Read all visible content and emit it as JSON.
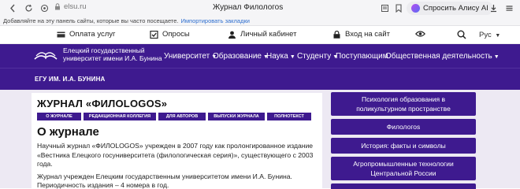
{
  "browser": {
    "url": "elsu.ru",
    "tab_title": "Журнал Филологоs",
    "alice_label": "Спросить Алису AI",
    "bookmarks_prompt": "Добавляйте на эту панель сайты, которые вы часто посещаете.",
    "bookmarks_import": "Импортировать закладки"
  },
  "utility": {
    "payment": "Оплата услуг",
    "surveys": "Опросы",
    "cabinet": "Личный кабинет",
    "login": "Вход на сайт",
    "language": "Рус"
  },
  "nav": {
    "logo_text": "Елецкий государственный университет имени И.А. Бунина",
    "items": [
      {
        "label": "Университет"
      },
      {
        "label": "Образование"
      },
      {
        "label": "Наука"
      },
      {
        "label": "Студенту"
      },
      {
        "label": "Поступающим"
      },
      {
        "label": "Общественная деятельность"
      }
    ],
    "brand": "ЕГУ ИМ. И.А. БУНИНА"
  },
  "article": {
    "journal_title": "ЖУРНАЛ «ФИЛОLOGOS»",
    "tabs": [
      {
        "label": "О ЖУРНАЛЕ"
      },
      {
        "label": "РЕДАКЦИОННАЯ КОЛЛЕГИЯ"
      },
      {
        "label": "ДЛЯ АВТОРОВ"
      },
      {
        "label": "ВЫПУСКИ ЖУРНАЛА"
      },
      {
        "label": "ПОЛНОТЕКСТ"
      }
    ],
    "heading": "О журнале",
    "para1": "Научный журнал «ФИЛОLOGOS» учрежден в 2007 году как пролонгированное издание «Вестника Елецкого госуниверситета (филологическая серия)», существующего с 2003 года.",
    "para2": "Журнал учрежден Елецким государственным университетом имени И.А. Бунина. Периодичность издания – 4 номера в год."
  },
  "sidebar": {
    "items": [
      {
        "label": "Психология образования в поликультурном пространстве"
      },
      {
        "label": "Филологоs"
      },
      {
        "label": "История: факты и символы"
      },
      {
        "label": "Агропромышленные технологии Центральной России"
      }
    ]
  },
  "colors": {
    "brand_purple": "#3e1a8f",
    "content_bg": "#ede9f3"
  }
}
